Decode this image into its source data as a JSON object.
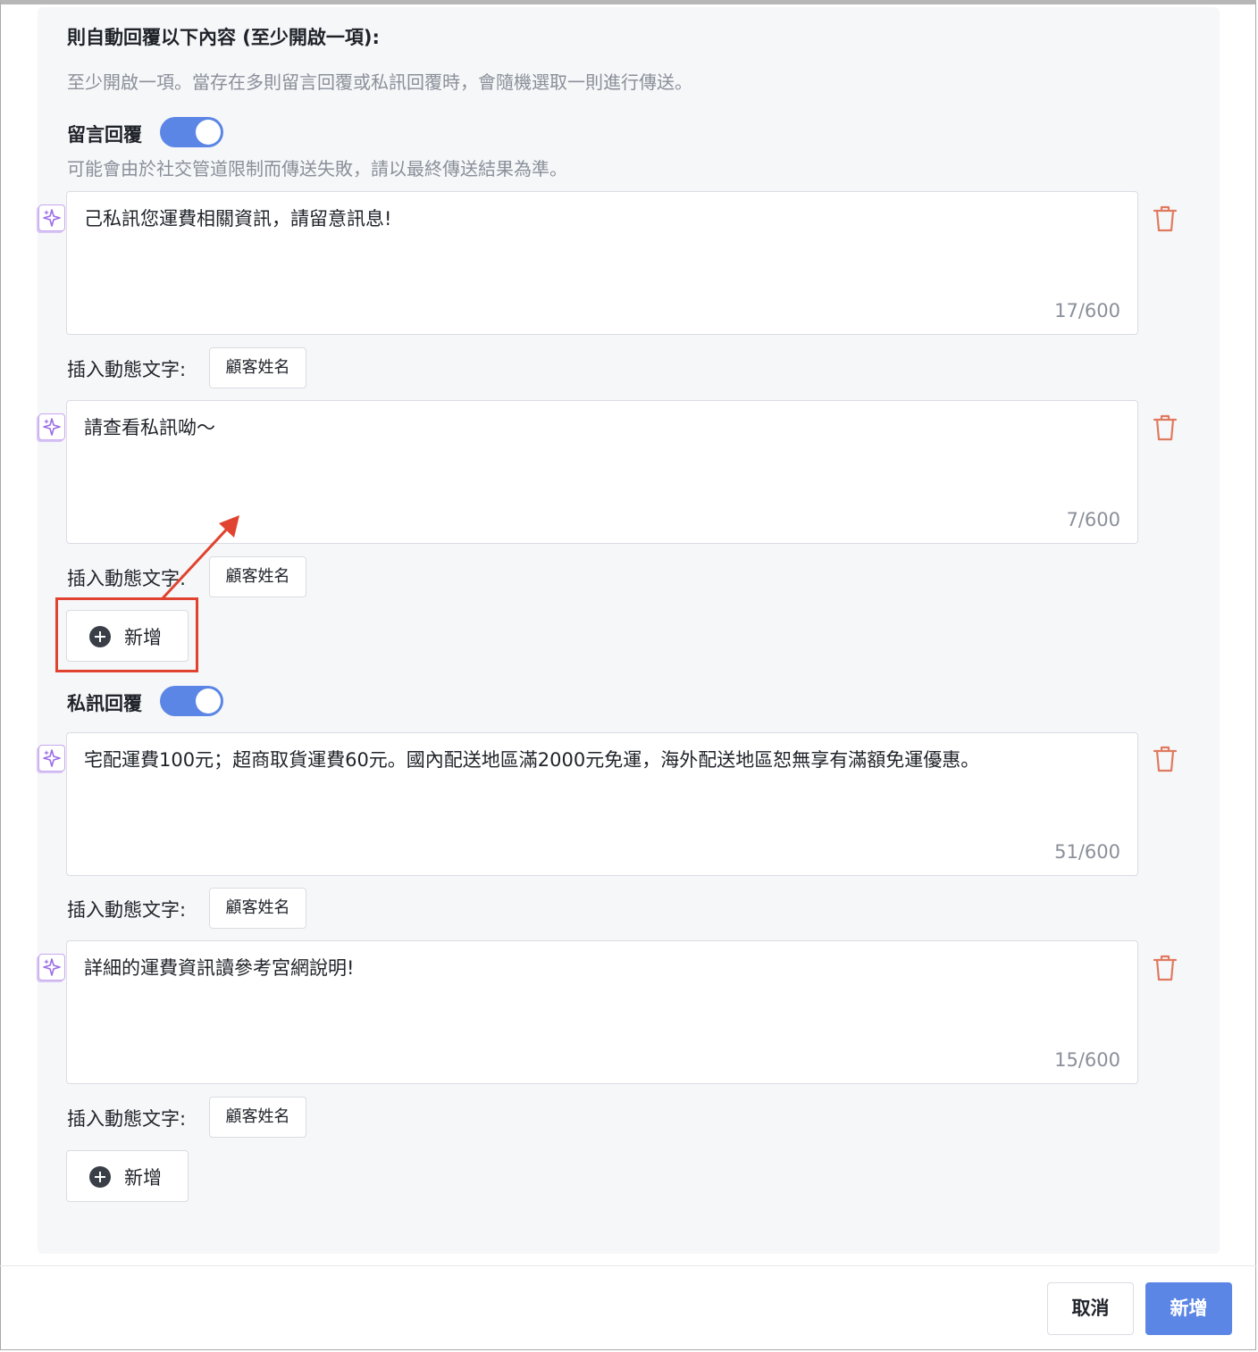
{
  "section": {
    "heading": "則自動回覆以下內容 (至少開啟一項):",
    "hint": "至少開啟一項。當存在多則留言回覆或私訊回覆時，會隨機選取一則進行傳送。"
  },
  "comment_reply": {
    "label": "留言回覆",
    "enabled": true,
    "hint": "可能會由於社交管道限制而傳送失敗，請以最終傳送結果為準。",
    "messages": [
      {
        "text": "己私訊您運費相關資訊，請留意訊息!",
        "counter": "17/600"
      },
      {
        "text": "請查看私訊呦～",
        "counter": "7/600"
      }
    ],
    "add_label": "新增"
  },
  "dm_reply": {
    "label": "私訊回覆",
    "enabled": true,
    "messages": [
      {
        "text": "宅配運費100元；超商取貨運費60元。國內配送地區滿2000元免運，海外配送地區恕無享有滿額免運優惠。",
        "counter": "51/600"
      },
      {
        "text": "詳細的運費資訊讀參考宮網說明!",
        "counter": "15/600"
      }
    ],
    "add_label": "新增"
  },
  "insert": {
    "label": "插入動態文字:",
    "tag": "顧客姓名"
  },
  "footer": {
    "cancel_label": "取消",
    "submit_label": "新增"
  },
  "colors": {
    "accent": "#5b86e5",
    "trash": "#e07a5f",
    "ai_icon": "#9b6ee6",
    "annotation": "#e0432f"
  }
}
